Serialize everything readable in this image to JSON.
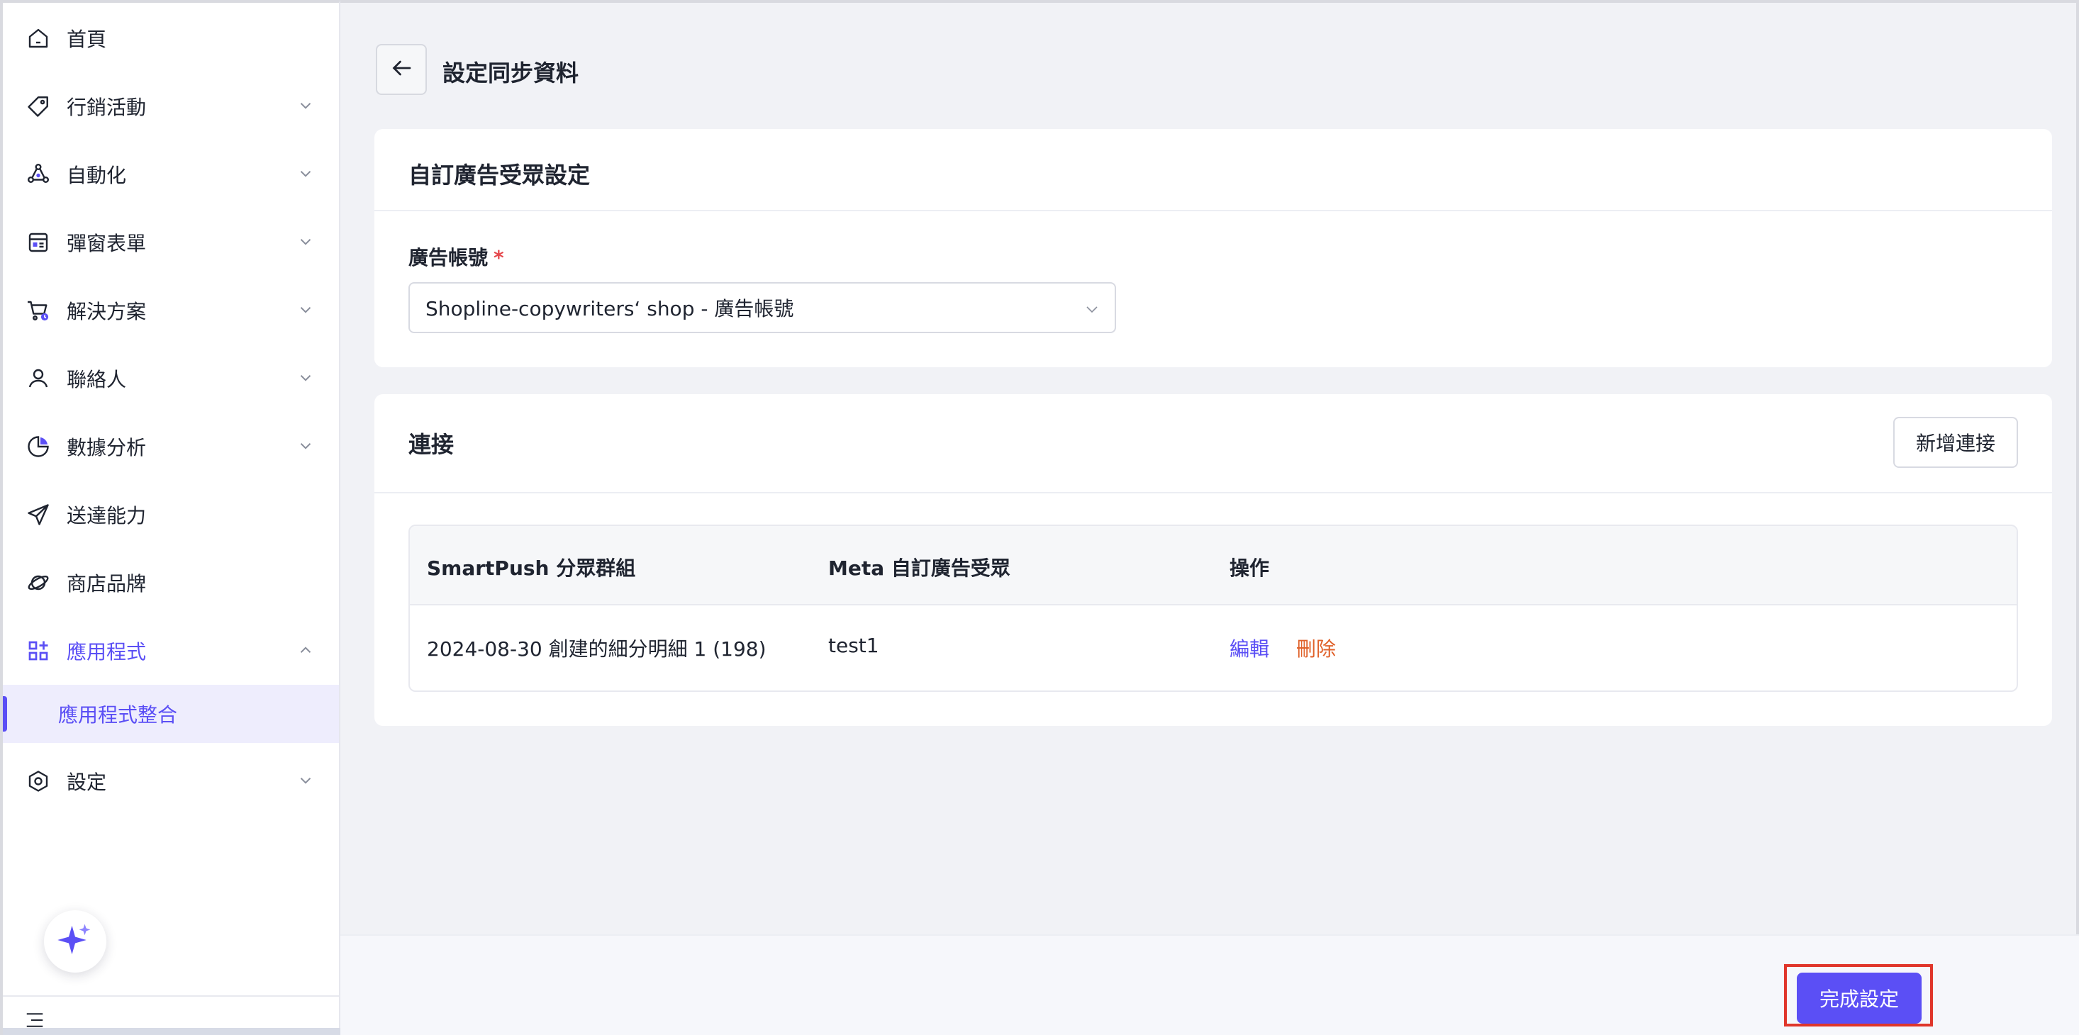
{
  "sidebar": {
    "items": [
      {
        "label": "首頁",
        "icon": "home-icon",
        "has_chevron": false
      },
      {
        "label": "行銷活動",
        "icon": "tag-icon",
        "has_chevron": true
      },
      {
        "label": "自動化",
        "icon": "automation-icon",
        "has_chevron": true
      },
      {
        "label": "彈窗表單",
        "icon": "form-icon",
        "has_chevron": true
      },
      {
        "label": "解決方案",
        "icon": "cart-icon",
        "has_chevron": true
      },
      {
        "label": "聯絡人",
        "icon": "user-icon",
        "has_chevron": true
      },
      {
        "label": "數據分析",
        "icon": "pie-chart-icon",
        "has_chevron": true
      },
      {
        "label": "送達能力",
        "icon": "send-icon",
        "has_chevron": false
      },
      {
        "label": "商店品牌",
        "icon": "brand-icon",
        "has_chevron": false
      },
      {
        "label": "應用程式",
        "icon": "apps-icon",
        "has_chevron": true,
        "expanded": true,
        "active": true
      },
      {
        "label": "設定",
        "icon": "settings-icon",
        "has_chevron": true
      }
    ],
    "sub_item": {
      "label": "應用程式整合"
    },
    "accent_color": "#5b4ff5"
  },
  "header": {
    "title": "設定同步資料"
  },
  "audience_card": {
    "title": "自訂廣告受眾設定",
    "field_label": "廣告帳號",
    "required_mark": "*",
    "selected_value": "Shopline-copywriters‘ shop - 廣告帳號"
  },
  "connection_card": {
    "title": "連接",
    "add_button_label": "新增連接",
    "table": {
      "columns": [
        "SmartPush 分眾群組",
        "Meta 自訂廣告受眾",
        "操作"
      ],
      "rows": [
        {
          "segment": "2024-08-30 創建的細分明細 1 (198)",
          "audience": "test1",
          "edit": "編輯",
          "delete": "刪除"
        }
      ]
    }
  },
  "footer": {
    "done_button_label": "完成設定"
  }
}
